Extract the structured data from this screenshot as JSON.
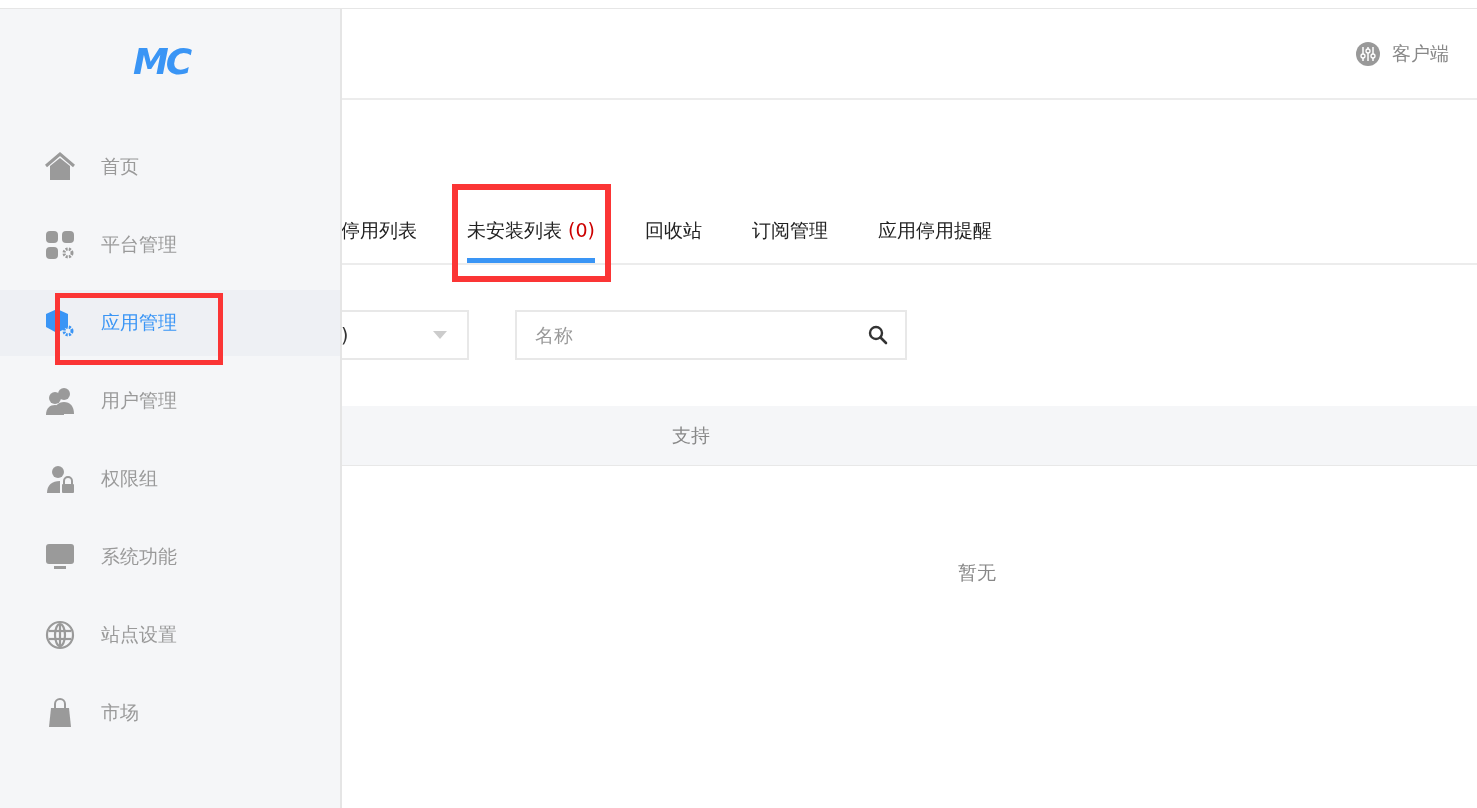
{
  "header": {
    "client_link": "客户端"
  },
  "sidebar": {
    "logo": "MC",
    "items": [
      {
        "label": "首页",
        "selected": false,
        "highlighted": false
      },
      {
        "label": "平台管理",
        "selected": false,
        "highlighted": false
      },
      {
        "label": "应用管理",
        "selected": true,
        "highlighted": true
      },
      {
        "label": "用户管理",
        "selected": false,
        "highlighted": false
      },
      {
        "label": "权限组",
        "selected": false,
        "highlighted": false
      },
      {
        "label": "系统功能",
        "selected": false,
        "highlighted": false
      },
      {
        "label": "站点设置",
        "selected": false,
        "highlighted": false
      },
      {
        "label": "市场",
        "selected": false,
        "highlighted": false
      }
    ]
  },
  "tabs": [
    {
      "label": "停用列表",
      "selected": false,
      "highlighted": false
    },
    {
      "label": "未安装列表",
      "count": "(0)",
      "selected": true,
      "highlighted": true
    },
    {
      "label": "回收站",
      "selected": false,
      "highlighted": false
    },
    {
      "label": "订阅管理",
      "selected": false,
      "highlighted": false
    },
    {
      "label": "应用停用提醒",
      "selected": false,
      "highlighted": false
    }
  ],
  "filter": {
    "select_value": ")",
    "search": {
      "placeholder": "名称"
    }
  },
  "table": {
    "columns": [
      "支持"
    ],
    "empty_text": "暂无"
  }
}
